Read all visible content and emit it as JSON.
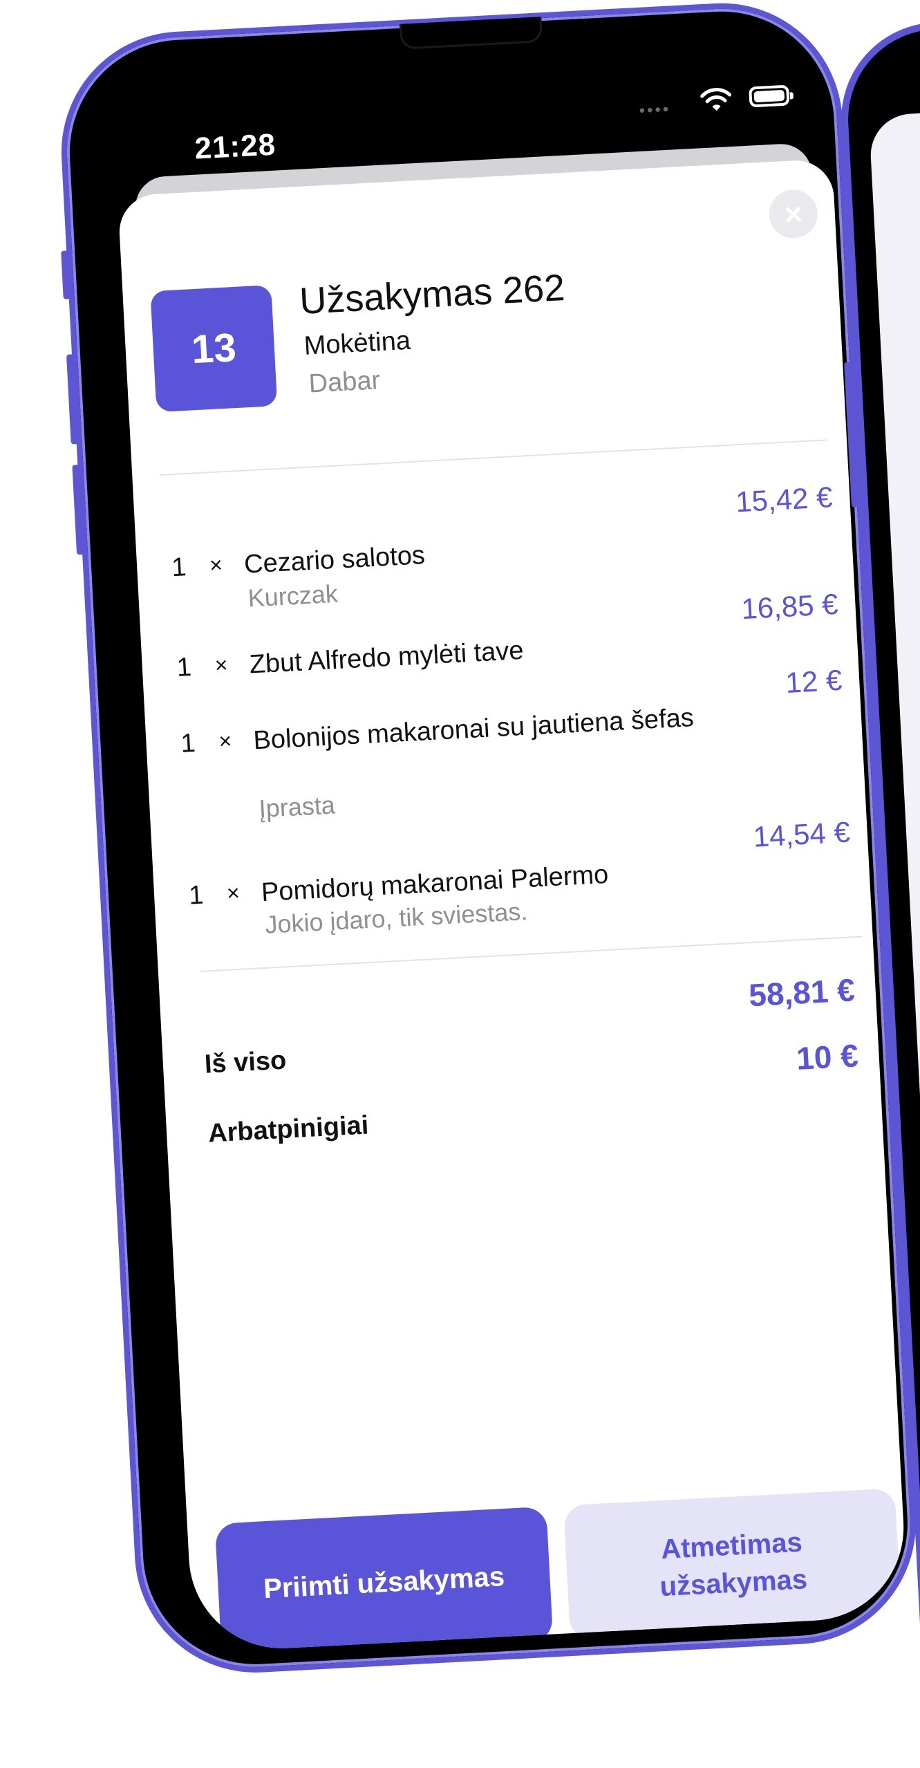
{
  "status_bar": {
    "time": "21:28",
    "signal_icon": "signal-dots-icon",
    "wifi_icon": "wifi-icon",
    "battery_icon": "battery-icon"
  },
  "order": {
    "table_number": "13",
    "title": "Užsakymas 262",
    "payment_status": "Mokėtina",
    "time": "Dabar"
  },
  "close_icon": "×",
  "items": [
    {
      "qty": "1",
      "times": "×",
      "name": "Cezario salotos",
      "note": "Kurczak",
      "price": "15,42 €"
    },
    {
      "qty": "1",
      "times": "×",
      "name": "Zbut Alfredo mylėti tave",
      "note": "",
      "price": "16,85 €"
    },
    {
      "qty": "1",
      "times": "×",
      "name": "Bolonijos makaronai su jautiena šefas",
      "note": "Įprasta",
      "price": "12 €"
    },
    {
      "qty": "1",
      "times": "×",
      "name": "Pomidorų makaronai Palermo",
      "note": "Jokio įdaro, tik sviestas.",
      "price": "14,54 €"
    }
  ],
  "summary": {
    "total_label": "Iš viso",
    "total_value": "58,81 €",
    "tip_label": "Arbatpinigiai",
    "tip_value": "10 €"
  },
  "actions": {
    "accept_label": "Priimti užsakymas",
    "reject_label": "Atmetimas užsakymas"
  },
  "colors": {
    "accent": "#5a55d8",
    "accent_light": "#e4e3f8",
    "frame": "#5c55d4"
  }
}
